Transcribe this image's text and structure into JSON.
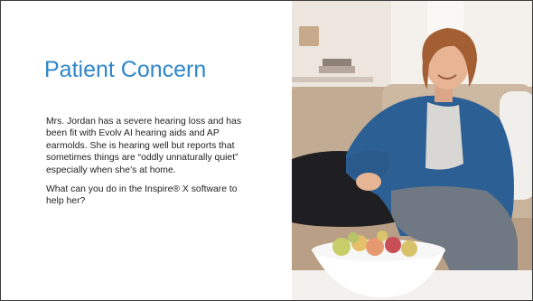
{
  "slide": {
    "title": "Patient Concern",
    "paragraphs": [
      "Mrs. Jordan has a severe hearing loss and has been fit with Evolv AI hearing aids and AP earmolds. She is hearing well but reports that sometimes things are “oddly unnaturally quiet” especially when she’s at home.",
      "What can you do in the Inspire® X software to help her?"
    ]
  },
  "photo": {
    "subject": "smiling older woman on sofa with dog",
    "colors": {
      "wall": "#ece6df",
      "sofa": "#c9b39c",
      "cardigan": "#2c5f93",
      "jeans": "#6f7883",
      "dog": "#1f1f22",
      "hair": "#a45e34",
      "skin": "#e7b594",
      "cushion": "#f1efeb",
      "bowl": "#ffffff"
    }
  }
}
